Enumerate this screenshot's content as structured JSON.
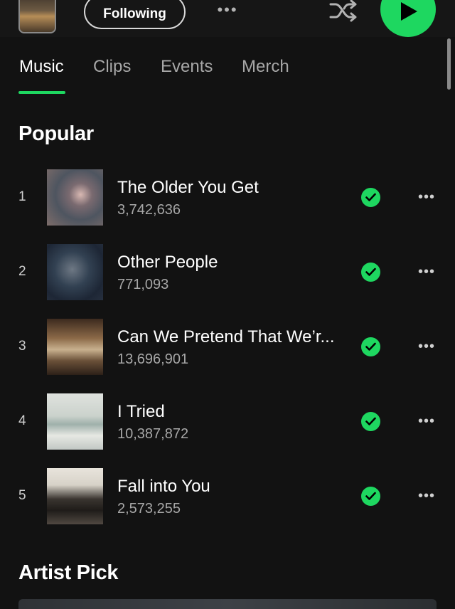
{
  "header": {
    "follow_label": "Following",
    "more_label": "•••",
    "shuffle_icon": "shuffle-icon",
    "play_icon": "play-icon",
    "accent_color": "#1ed760"
  },
  "tabs": [
    {
      "label": "Music",
      "active": true
    },
    {
      "label": "Clips",
      "active": false
    },
    {
      "label": "Events",
      "active": false
    },
    {
      "label": "Merch",
      "active": false
    }
  ],
  "popular": {
    "title": "Popular",
    "tracks": [
      {
        "rank": "1",
        "title": "The Older You Get",
        "plays": "3,742,636",
        "saved": true
      },
      {
        "rank": "2",
        "title": "Other People",
        "plays": "771,093",
        "saved": true
      },
      {
        "rank": "3",
        "title": "Can We Pretend That We’r...",
        "plays": "13,696,901",
        "saved": true
      },
      {
        "rank": "4",
        "title": "I Tried",
        "plays": "10,387,872",
        "saved": true
      },
      {
        "rank": "5",
        "title": "Fall into You",
        "plays": "2,573,255",
        "saved": true
      }
    ],
    "more_label": "•••"
  },
  "artist_pick": {
    "title": "Artist Pick"
  }
}
